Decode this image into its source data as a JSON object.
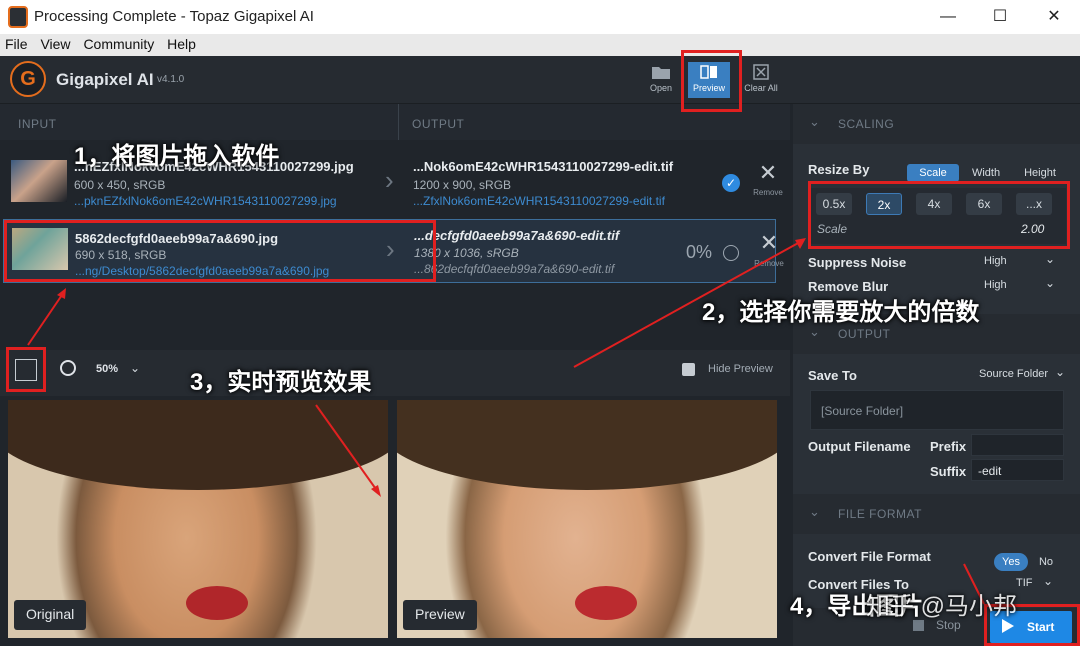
{
  "window": {
    "title": "Processing Complete - Topaz Gigapixel AI"
  },
  "menu": [
    "File",
    "View",
    "Community",
    "Help"
  ],
  "app": {
    "name": "Gigapixel AI",
    "version": "v4.1.0",
    "logo_letter": "G"
  },
  "toolbar": {
    "open": "Open",
    "preview": "Preview",
    "clear_all": "Clear All"
  },
  "columns": {
    "input": "INPUT",
    "output": "OUTPUT"
  },
  "files": [
    {
      "in_name": "...nEZfxlNok6omE42cWHR1543110027299.jpg",
      "in_dim": "600 x 450, sRGB",
      "in_path": "...pknEZfxlNok6omE42cWHR1543110027299.jpg",
      "out_name": "...Nok6omE42cWHR1543110027299-edit.tif",
      "out_dim": "1200 x 900, sRGB",
      "out_path": "...ZfxlNok6omE42cWHR1543110027299-edit.tif",
      "remove": "Remove"
    },
    {
      "in_name": "5862decfgfd0aeeb99a7a&690.jpg",
      "in_dim": "690 x 518, sRGB",
      "in_path": "...ng/Desktop/5862decfgfd0aeeb99a7a&690.jpg",
      "out_name": "...decfgfd0aeeb99a7a&690-edit.tif",
      "out_dim": "1380 x 1036, sRGB",
      "out_path": "...862decfqfd0aeeb99a7a&690-edit.tif",
      "progress": "0%",
      "remove": "Remove"
    }
  ],
  "preview_bar": {
    "zoom": "50%",
    "hide_preview": "Hide Preview"
  },
  "preview": {
    "original_label": "Original",
    "preview_label": "Preview"
  },
  "scaling": {
    "section": "SCALING",
    "resize_by_label": "Resize By",
    "resize_modes": [
      "Scale",
      "Width",
      "Height"
    ],
    "scale_options": [
      "0.5x",
      "2x",
      "4x",
      "6x",
      "...x"
    ],
    "scale_label": "Scale",
    "scale_value": "2.00",
    "suppress_noise_label": "Suppress Noise",
    "suppress_noise_value": "High",
    "remove_blur_label": "Remove Blur",
    "remove_blur_value": "High"
  },
  "output": {
    "section": "OUTPUT",
    "save_to_label": "Save To",
    "save_to_value": "Source Folder",
    "folder_placeholder": "[Source Folder]",
    "filename_label": "Output Filename",
    "prefix_label": "Prefix",
    "suffix_label": "Suffix",
    "suffix_value": "-edit"
  },
  "file_format": {
    "section": "FILE FORMAT",
    "convert_label": "Convert File Format",
    "yes": "Yes",
    "no": "No",
    "convert_to_label": "Convert Files To",
    "convert_to_value": "TIF"
  },
  "actions": {
    "stop": "Stop",
    "start": "Start"
  },
  "annotations": {
    "step1": "1，将图片拖入软件",
    "step2": "2，选择你需要放大的倍数",
    "step3": "3，实时预览效果",
    "step4": "4，导出图片",
    "watermark": "知乎 @马小邦"
  },
  "colors": {
    "accent": "#3a7fc1",
    "logo": "#e46d1d",
    "annotation": "#e02020",
    "start": "#1e88e5"
  }
}
